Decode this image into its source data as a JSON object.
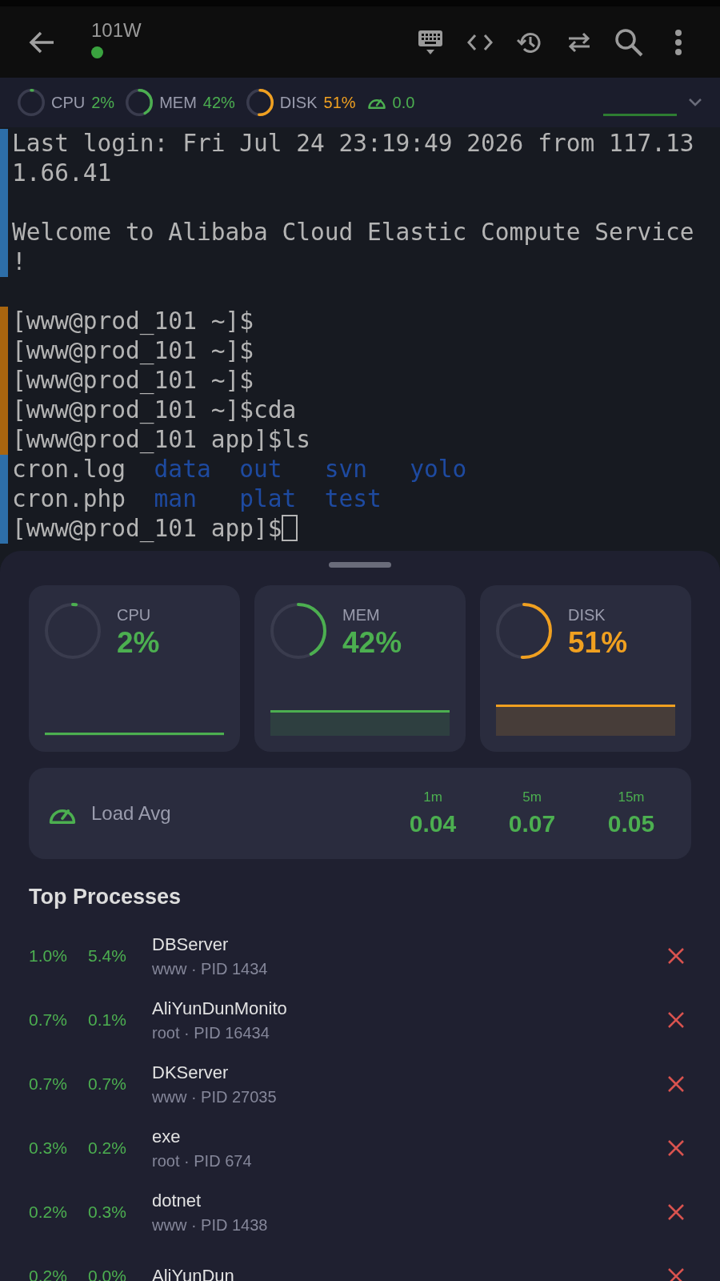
{
  "top_bar": {
    "title": "101W",
    "online": true
  },
  "terminal": {
    "blocks": [
      {
        "color": "#2d6ea8",
        "lines": [
          {
            "kind": "text",
            "text": "Last login: Fri Jul 24 23:19:49 2026 from 117.131.66.41"
          },
          {
            "kind": "text",
            "text": "Welcome to Alibaba Cloud Elastic Compute Service !",
            "blank_before": true
          }
        ]
      },
      {
        "color": "#a8650f",
        "blank_before": true,
        "lines": [
          {
            "kind": "text",
            "text": "[www@prod_101 ~]$"
          },
          {
            "kind": "text",
            "text": "[www@prod_101 ~]$"
          },
          {
            "kind": "text",
            "text": "[www@prod_101 ~]$"
          },
          {
            "kind": "text",
            "text": "[www@prod_101 ~]$cda"
          },
          {
            "kind": "text",
            "text": "[www@prod_101 app]$ls"
          }
        ]
      },
      {
        "color": "#2d6ea8",
        "lines": [
          {
            "kind": "listing",
            "items": [
              {
                "text": "cron.log",
                "kind": "file"
              },
              {
                "text": "data",
                "kind": "dir"
              },
              {
                "text": "out",
                "kind": "dir"
              },
              {
                "text": "svn",
                "kind": "dir"
              },
              {
                "text": "yolo",
                "kind": "dir"
              },
              {
                "text": "cron.php",
                "kind": "file"
              },
              {
                "text": "man",
                "kind": "dir"
              },
              {
                "text": "plat",
                "kind": "dir"
              },
              {
                "text": "test",
                "kind": "dir"
              }
            ]
          },
          {
            "kind": "text",
            "text": "[www@prod_101 app]$",
            "cursor": true
          }
        ]
      }
    ]
  },
  "stats_bar": {
    "metrics": [
      {
        "label": "CPU",
        "value": "2%",
        "level": 0.02,
        "color": "#4caf50"
      },
      {
        "label": "MEM",
        "value": "42%",
        "level": 0.42,
        "color": "#4caf50"
      },
      {
        "label": "DISK",
        "value": "51%",
        "level": 0.51,
        "color": "#f0a020"
      }
    ],
    "load": "0.0"
  },
  "metric_cards": [
    {
      "label": "CPU",
      "value": "2%",
      "level": 0.02,
      "color": "#4caf50"
    },
    {
      "label": "MEM",
      "value": "42%",
      "level": 0.42,
      "color": "#4caf50"
    },
    {
      "label": "DISK",
      "value": "51%",
      "level": 0.51,
      "color": "#f0a020"
    }
  ],
  "load_avg": {
    "label": "Load Avg",
    "values": [
      {
        "period": "1m",
        "value": "0.04"
      },
      {
        "period": "5m",
        "value": "0.07"
      },
      {
        "period": "15m",
        "value": "0.05"
      }
    ]
  },
  "processes": {
    "title": "Top Processes",
    "rows": [
      {
        "cpu": "1.0%",
        "mem": "5.4%",
        "name": "DBServer",
        "detail": "www · PID 1434"
      },
      {
        "cpu": "0.7%",
        "mem": "0.1%",
        "name": "AliYunDunMonito",
        "detail": "root · PID 16434"
      },
      {
        "cpu": "0.7%",
        "mem": "0.7%",
        "name": "DKServer",
        "detail": "www · PID 27035"
      },
      {
        "cpu": "0.3%",
        "mem": "0.2%",
        "name": "exe",
        "detail": "root · PID 674"
      },
      {
        "cpu": "0.2%",
        "mem": "0.3%",
        "name": "dotnet",
        "detail": "www · PID 1438"
      },
      {
        "cpu": "0.2%",
        "mem": "0.0%",
        "name": "AliYunDun"
      }
    ]
  }
}
